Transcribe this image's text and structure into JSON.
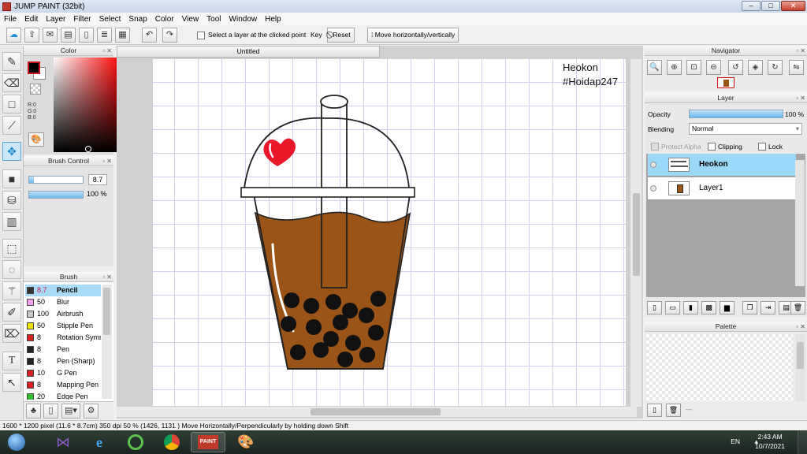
{
  "app": {
    "title": "JUMP PAINT (32bit)"
  },
  "window_controls": {
    "minimize": "–",
    "maximize": "□",
    "close": "✕"
  },
  "menu": [
    "File",
    "Edit",
    "Layer",
    "Filter",
    "Select",
    "Snap",
    "Color",
    "View",
    "Tool",
    "Window",
    "Help"
  ],
  "toolbar": {
    "select_layer_label": "Select a layer at the clicked point",
    "key_label": "Key",
    "reset_label": "Reset",
    "move_label": "Move horizontally/vertically"
  },
  "color_panel": {
    "title": "Color",
    "r": "R:0",
    "g": "G:0",
    "b": "B:0",
    "main_color": "#000000",
    "sub_color": "#ffffff"
  },
  "brush_control": {
    "title": "Brush Control",
    "size_value": "8.7",
    "size_fraction": 0.087,
    "opacity_value": "100 %",
    "opacity_fraction": 1.0
  },
  "brush_panel": {
    "title": "Brush",
    "items": [
      {
        "size": "8.7",
        "name": "Pencil",
        "color": "#333333"
      },
      {
        "size": "50",
        "name": "Blur",
        "color": "#f6a3ef"
      },
      {
        "size": "100",
        "name": "Airbrush",
        "color": "#c8c8c8"
      },
      {
        "size": "50",
        "name": "Stipple Pen",
        "color": "#f0e000"
      },
      {
        "size": "8",
        "name": "Rotation Symm",
        "color": "#d82020"
      },
      {
        "size": "8",
        "name": "Pen",
        "color": "#222222"
      },
      {
        "size": "8",
        "name": "Pen (Sharp)",
        "color": "#222222"
      },
      {
        "size": "10",
        "name": "G Pen",
        "color": "#d82020"
      },
      {
        "size": "8",
        "name": "Mapping Pen",
        "color": "#d82020"
      },
      {
        "size": "20",
        "name": "Edge Pen",
        "color": "#30c030"
      }
    ]
  },
  "document": {
    "tab_title": "Untitled",
    "signature_line1": "Heokon",
    "signature_line2": "#Hoidap247"
  },
  "navigator": {
    "title": "Navigator"
  },
  "layer_panel": {
    "title": "Layer",
    "opacity_label": "Opacity",
    "opacity_value": "100 %",
    "opacity_fraction": 1.0,
    "blending_label": "Blending",
    "blending_value": "Normal",
    "protect_alpha_label": "Protect Alpha",
    "clipping_label": "Clipping",
    "lock_label": "Lock",
    "layers": [
      {
        "name": "Heokon",
        "selected": true
      },
      {
        "name": "Layer1",
        "selected": false
      }
    ]
  },
  "palette_panel": {
    "title": "Palette",
    "footer_text": "---"
  },
  "statusbar": {
    "text": "1600 * 1200 pixel  (11.6 * 8.7cm)  350 dpi  50 %  (1426, 1131 )  Move Horizontally/Perpendicularly by holding down Shift"
  },
  "taskbar": {
    "lang": "EN",
    "time": "2:43 AM",
    "date": "10/7/2021"
  }
}
